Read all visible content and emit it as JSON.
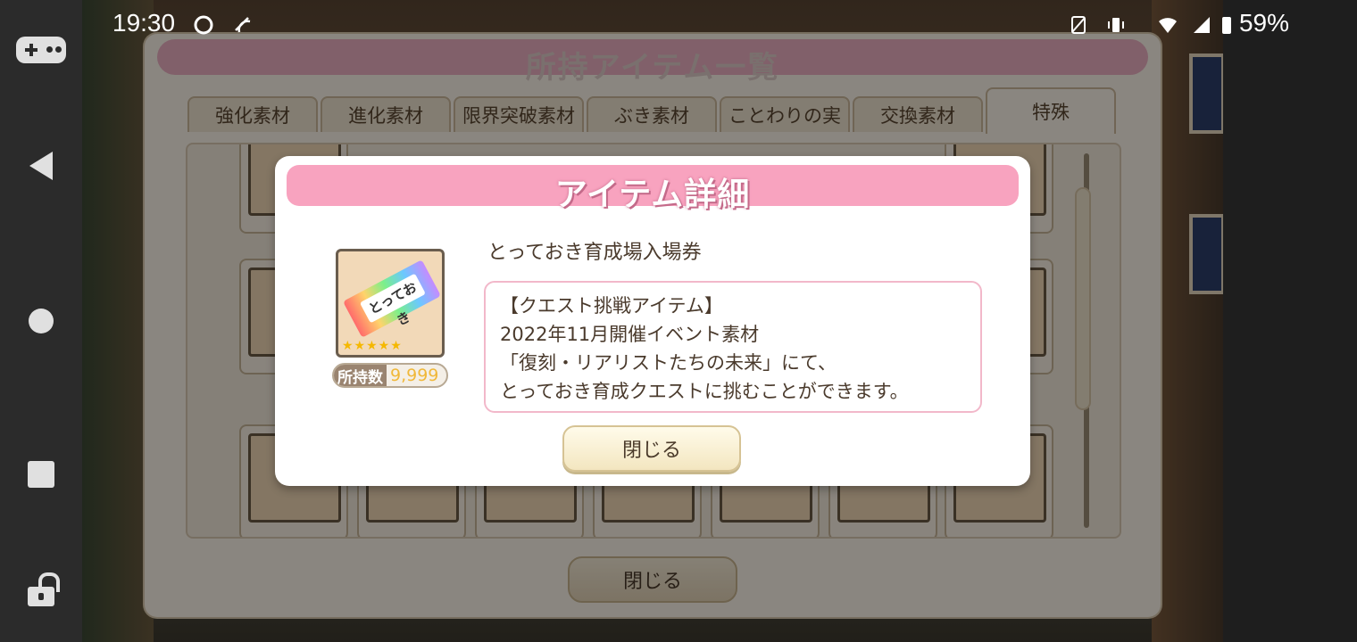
{
  "status_bar": {
    "time": "19:30",
    "battery": "59%",
    "icons": [
      "sync-icon",
      "nfc-icon",
      "no-sim-icon",
      "vibrate-icon",
      "wifi-icon",
      "signal-icon",
      "battery-icon"
    ]
  },
  "nav_rail": {
    "icons": [
      "gamepad-icon",
      "back-icon",
      "home-icon",
      "recents-icon",
      "lock-icon"
    ]
  },
  "panel": {
    "title": "所持アイテム一覧",
    "tabs": [
      "強化素材",
      "進化素材",
      "限界突破素材",
      "ぶき素材",
      "ことわりの実",
      "交換素材",
      "特殊"
    ],
    "active_tab": "特殊",
    "close_label": "閉じる"
  },
  "dialog": {
    "title": "アイテム詳細",
    "item_name": "とっておき育成場入場券",
    "icon_text": "とっておき",
    "icon_stars": "★★★★★",
    "quantity_label": "所持数",
    "quantity_value": "9,999",
    "description_lines": [
      "【クエスト挑戦アイテム】",
      "2022年11月開催イベント素材",
      "「復刻・リアリストたちの未来」にて、",
      "とっておき育成クエストに挑むことができます。"
    ],
    "close_label": "閉じる"
  },
  "colors": {
    "dialog_title_bar": "#f8a3bf",
    "panel_bg": "#fbf4ea",
    "quantity_value": "#f0b83a"
  }
}
